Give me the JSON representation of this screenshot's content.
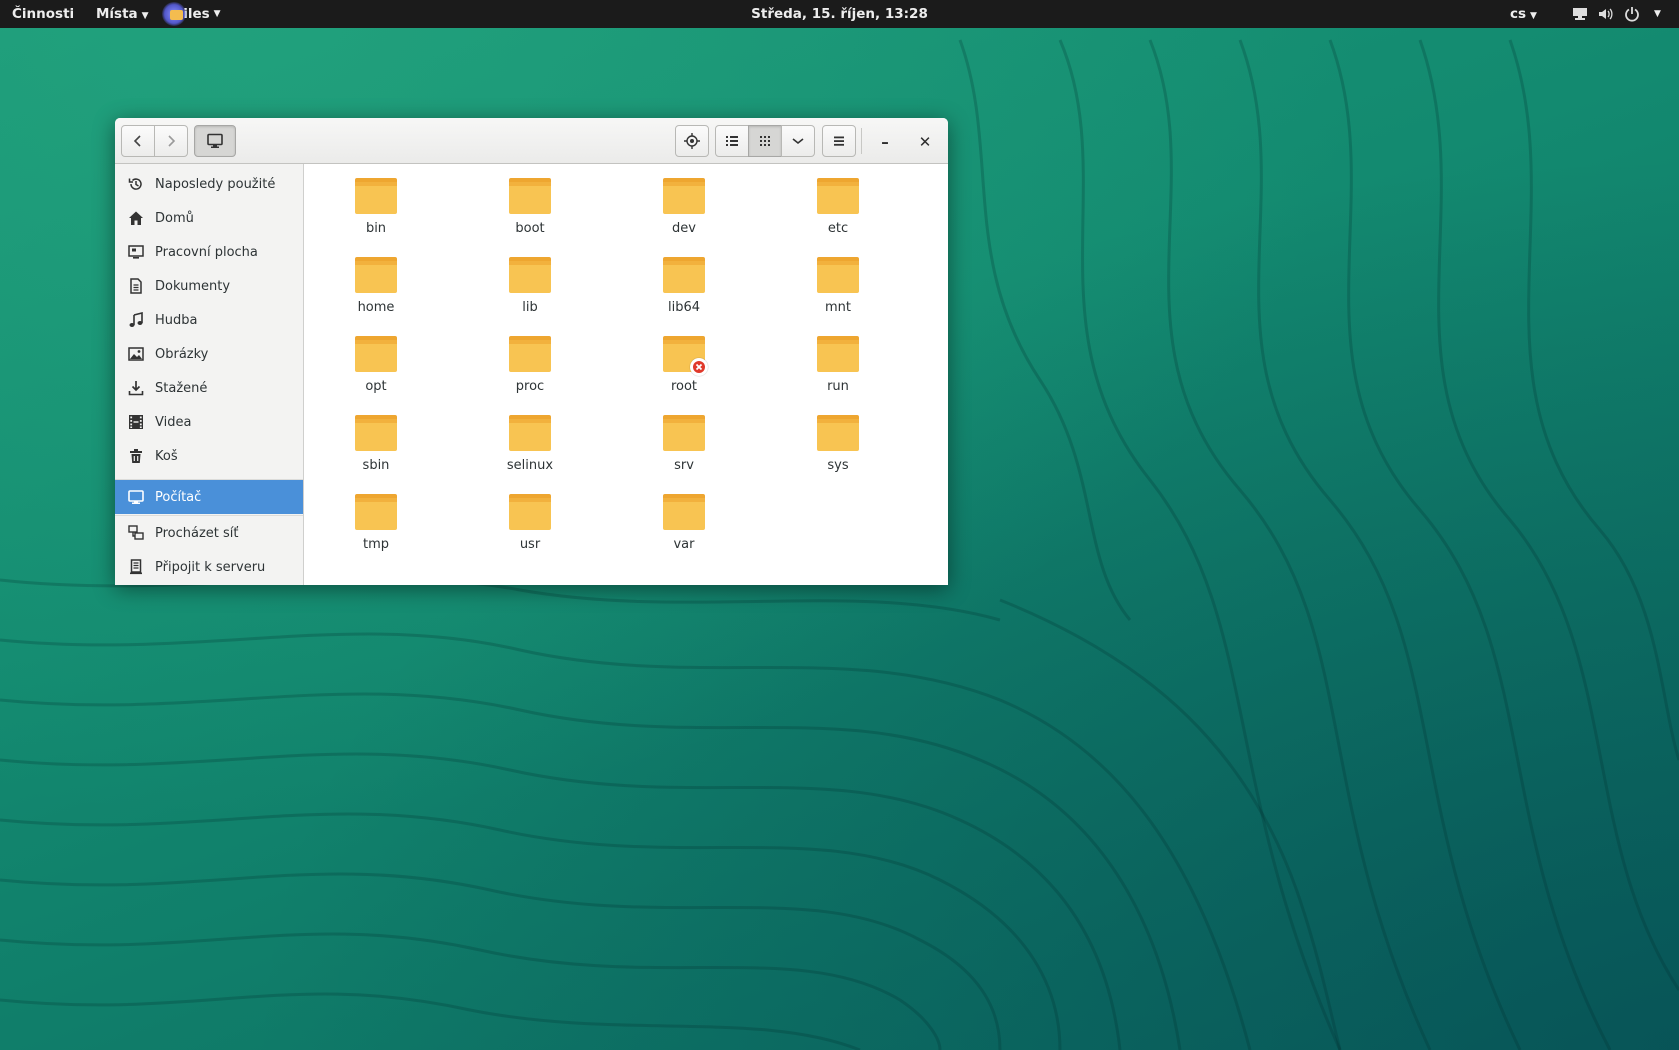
{
  "topbar": {
    "activities": "Činnosti",
    "places": "Místa",
    "app_name": "Files",
    "clock": "Středa, 15. říjen, 13:28",
    "language": "cs"
  },
  "window": {
    "header": {
      "icons": [
        "back-icon",
        "forward-icon",
        "computer-icon",
        "locate-icon",
        "list-view-icon",
        "grid-view-icon",
        "chevron-down-icon",
        "hamburger-menu-icon",
        "minimize-icon",
        "close-icon"
      ],
      "minimize": "–",
      "close": "✕"
    },
    "sidebar": {
      "items": [
        {
          "label": "Naposledy použité",
          "icon": "recent-icon"
        },
        {
          "label": "Domů",
          "icon": "home-icon"
        },
        {
          "label": "Pracovní plocha",
          "icon": "desktop-icon"
        },
        {
          "label": "Dokumenty",
          "icon": "document-icon"
        },
        {
          "label": "Hudba",
          "icon": "music-icon"
        },
        {
          "label": "Obrázky",
          "icon": "pictures-icon"
        },
        {
          "label": "Stažené",
          "icon": "download-icon"
        },
        {
          "label": "Videa",
          "icon": "video-icon"
        },
        {
          "label": "Koš",
          "icon": "trash-icon"
        }
      ],
      "device": {
        "label": "Počítač",
        "icon": "computer-icon",
        "selected": true
      },
      "network": [
        {
          "label": "Procházet síť",
          "icon": "network-icon"
        },
        {
          "label": "Připojit k serveru",
          "icon": "server-icon"
        }
      ]
    },
    "files": [
      {
        "name": "bin"
      },
      {
        "name": "boot"
      },
      {
        "name": "dev"
      },
      {
        "name": "etc"
      },
      {
        "name": "home"
      },
      {
        "name": "lib"
      },
      {
        "name": "lib64"
      },
      {
        "name": "mnt"
      },
      {
        "name": "opt"
      },
      {
        "name": "proc"
      },
      {
        "name": "root",
        "emblem": "unreadable-icon"
      },
      {
        "name": "run"
      },
      {
        "name": "sbin"
      },
      {
        "name": "selinux"
      },
      {
        "name": "srv"
      },
      {
        "name": "sys"
      },
      {
        "name": "tmp"
      },
      {
        "name": "usr"
      },
      {
        "name": "var"
      }
    ]
  },
  "colors": {
    "selection": "#4a90d9",
    "folder": "#f8c452",
    "desktop": "#12806a",
    "topbar": "#1b1b1b"
  }
}
